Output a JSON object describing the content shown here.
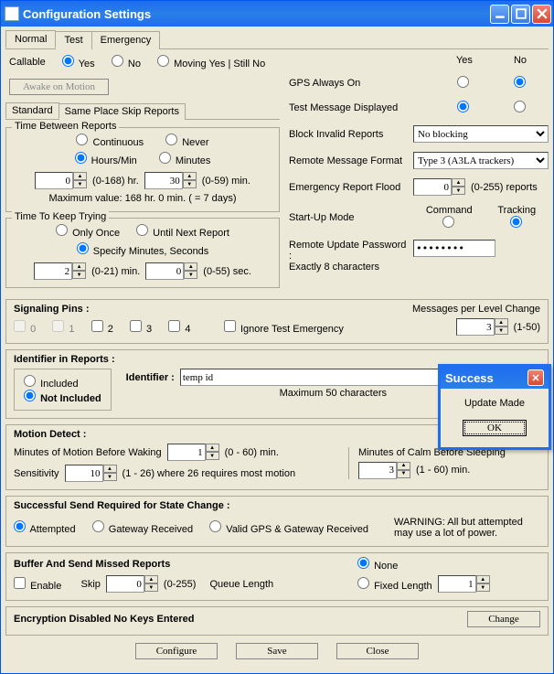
{
  "window": {
    "title": "Configuration Settings"
  },
  "tabs": {
    "normal": "Normal",
    "test": "Test",
    "emergency": "Emergency"
  },
  "callable": {
    "label": "Callable",
    "yes": "Yes",
    "no": "No",
    "moving": "Moving Yes | Still No"
  },
  "awake": {
    "label": "Awake on Motion"
  },
  "subtabs": {
    "standard": "Standard",
    "sameplace": "Same Place Skip Reports"
  },
  "timeBetween": {
    "title": "Time Between Reports",
    "continuous": "Continuous",
    "never": "Never",
    "hoursmin": "Hours/Min",
    "minutes": "Minutes",
    "hrVal": "0",
    "hrRange": "(0-168) hr.",
    "minVal": "30",
    "minRange": "(0-59) min.",
    "maxNote": "Maximum value: 168 hr. 0 min.  ( = 7 days)"
  },
  "timeKeep": {
    "title": "Time To Keep Trying",
    "onlyonce": "Only Once",
    "untilnext": "Until Next Report",
    "specify": "Specify Minutes, Seconds",
    "minVal": "2",
    "minRange": "(0-21) min.",
    "secVal": "0",
    "secRange": "(0-55) sec."
  },
  "right": {
    "yes": "Yes",
    "no": "No",
    "gps": "GPS Always On",
    "testmsg": "Test Message Displayed",
    "block": "Block Invalid Reports",
    "blockVal": "No blocking",
    "remoteFmt": "Remote Message Format",
    "remoteFmtVal": "Type 3 (A3LA trackers)",
    "flood": "Emergency Report Flood",
    "floodVal": "0",
    "floodRange": "(0-255) reports",
    "startup": "Start-Up Mode",
    "command": "Command",
    "tracking": "Tracking",
    "pwdLabel": "Remote Update Password :",
    "pwdNote": "Exactly 8 characters",
    "pwdVal": "xxxxxxxx"
  },
  "signaling": {
    "title": "Signaling Pins :",
    "p0": "0",
    "p1": "1",
    "p2": "2",
    "p3": "3",
    "p4": "4",
    "ignore": "Ignore Test Emergency",
    "msgs": "Messages per Level Change",
    "msgsVal": "3",
    "msgsRange": "(1-50)"
  },
  "identifier": {
    "title": "Identifier in Reports :",
    "included": "Included",
    "notincluded": "Not Included",
    "label": "Identifier :",
    "value": "temp id",
    "note": "Maximum 50 characters"
  },
  "motion": {
    "title": "Motion Detect :",
    "beforeWake": "Minutes of Motion Before Waking",
    "wakeVal": "1",
    "wakeRange": "(0 - 60) min.",
    "sens": "Sensitivity",
    "sensVal": "10",
    "sensNote": "(1 - 26) where 26 requires most motion",
    "beforeSleep": "Minutes of Calm Before Sleeping",
    "sleepVal": "3",
    "sleepRange": "(1 - 60) min."
  },
  "statechange": {
    "title": "Successful Send Required for State Change :",
    "attempted": "Attempted",
    "gateway": "Gateway Received",
    "valid": "Valid GPS & Gateway Received",
    "warn": "WARNING: All but attempted may use a lot of power."
  },
  "buffer": {
    "title": "Buffer And Send Missed Reports",
    "enable": "Enable",
    "skip": "Skip",
    "skipVal": "0",
    "skipRange": "(0-255)",
    "queue": "Queue Length",
    "none": "None",
    "fixed": "Fixed Length",
    "fixedVal": "1"
  },
  "encryption": {
    "label": "Encryption Disabled No Keys Entered",
    "change": "Change"
  },
  "footer": {
    "configure": "Configure",
    "save": "Save",
    "close": "Close"
  },
  "modal": {
    "title": "Success",
    "body": "Update Made",
    "ok": "OK"
  }
}
